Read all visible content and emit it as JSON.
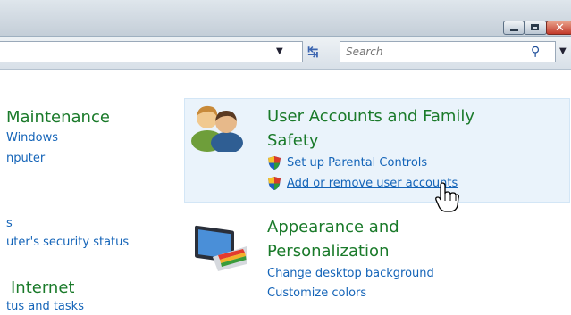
{
  "window": {
    "controls": {
      "minimize": "minimize",
      "maximize": "maximize",
      "close": "close"
    }
  },
  "toolbar": {
    "search_placeholder": "Search"
  },
  "left_column": {
    "maintenance_title": "Maintenance",
    "maintenance_link1": "Windows",
    "maintenance_link2": "nputer",
    "security_link1": "s",
    "security_link2": "uter's security status",
    "internet_title": "Internet",
    "internet_link1": "tus and tasks"
  },
  "user_accounts": {
    "title_line1": "User Accounts and Family",
    "title_line2": "Safety",
    "task1": "Set up Parental Controls",
    "task2": "Add or remove user accounts"
  },
  "appearance": {
    "title_line1": "Appearance and",
    "title_line2": "Personalization",
    "task1": "Change desktop background",
    "task2": "Customize colors"
  },
  "icons": {
    "user_accounts": "users-icon",
    "appearance": "display-palette-icon",
    "shield": "uac-shield-icon",
    "cursor": "hand-pointer-icon"
  }
}
